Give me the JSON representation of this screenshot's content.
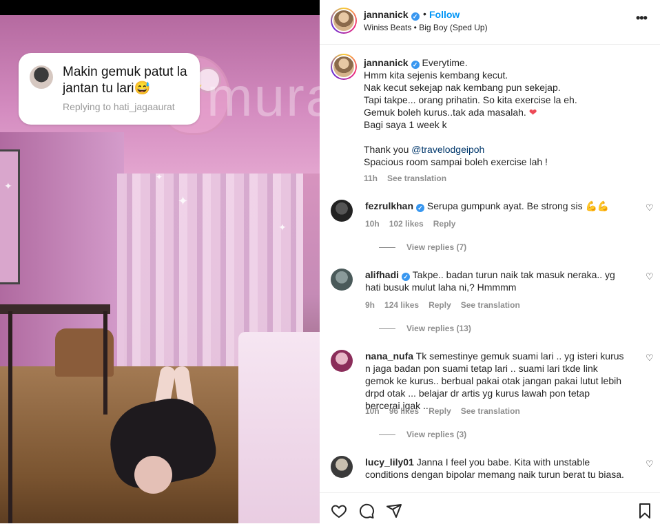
{
  "sticker": {
    "text": "Makin gemuk patut la jantan tu lari😅",
    "replying_to": "Replying to hati_jagaaurat"
  },
  "watermark": "murai",
  "header": {
    "username": "jannanick",
    "dot": "•",
    "follow_label": "Follow",
    "music": "Winiss Beats • Big Boy (Sped Up)",
    "more_icon": "more-icon"
  },
  "caption": {
    "username": "jannanick",
    "text_lines": "Everytime.\nHmm kita sejenis kembang kecut.\nNak kecut sekejap nak kembang pun sekejap.\nTapi takpe... orang prihatin. So kita exercise la eh.\nGemuk boleh kurus..tak ada masalah. ❤\nBagi saya 1 week k\n\nThank you @travelodgeipoh\nSpacious room sampai boleh exercise lah !",
    "time": "11h",
    "see_translation": "See translation"
  },
  "comments": [
    {
      "username": "fezrulkhan",
      "verified": true,
      "text": "Serupa gumpunk ayat. Be strong sis 💪💪",
      "time": "10h",
      "likes": "102 likes",
      "reply": "Reply",
      "see_translation": "",
      "view_replies": "View replies (7)"
    },
    {
      "username": "alifhadi",
      "verified": true,
      "text": "Takpe.. badan turun naik tak masuk neraka.. yg hati busuk mulut laha ni,? Hmmmm",
      "time": "9h",
      "likes": "124 likes",
      "reply": "Reply",
      "see_translation": "See translation",
      "view_replies": "View replies (13)"
    },
    {
      "username": "nana_nufa",
      "verified": false,
      "text": "Tk semestinye gemuk suami lari .. yg isteri kurus n jaga badan pon suami tetap lari .. suami lari tkde link gemok ke kurus.. berbual pakai otak jangan pakai lutut lebih drpd otak ... belajar dr artis yg kurus lawah pon tetap bercerai jgak ..",
      "time": "10h",
      "likes": "96 likes",
      "reply": "Reply",
      "see_translation": "See translation",
      "view_replies": "View replies (3)"
    },
    {
      "username": "lucy_lily01",
      "verified": false,
      "text": "Janna I feel you babe. Kita with unstable conditions dengan bipolar memang naik turun berat tu biasa.",
      "time": "",
      "likes": "",
      "reply": "",
      "see_translation": "",
      "view_replies": ""
    }
  ],
  "actions": {
    "like_icon": "heart-icon",
    "comment_icon": "comment-icon",
    "share_icon": "share-icon",
    "save_icon": "bookmark-icon"
  },
  "colors": {
    "link_blue": "#0095f6",
    "verified_blue": "#3897f0",
    "heart_red": "#ed4956"
  }
}
